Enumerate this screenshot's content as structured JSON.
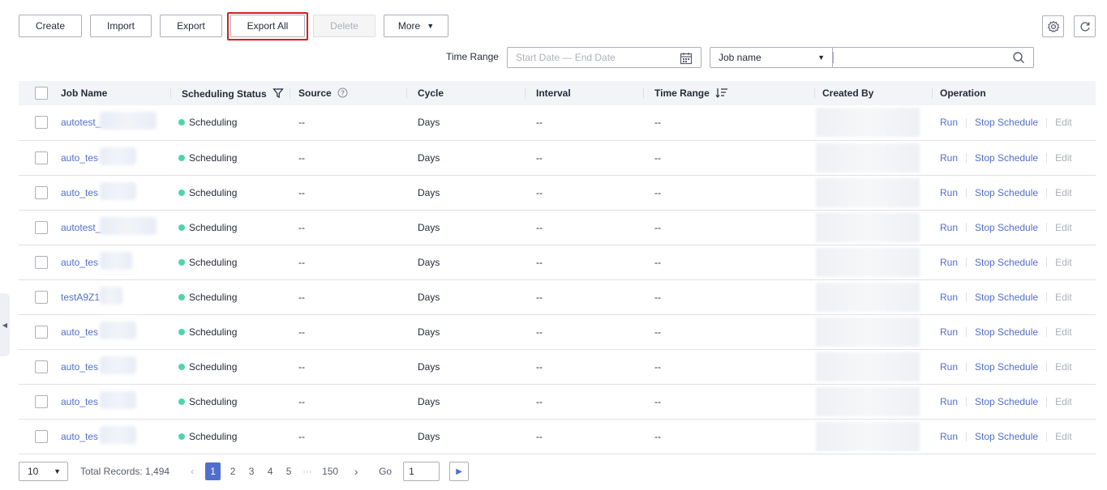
{
  "toolbar": {
    "create": "Create",
    "import": "Import",
    "export": "Export",
    "export_all": "Export All",
    "delete": "Delete",
    "more": "More"
  },
  "filters": {
    "time_range_label": "Time Range",
    "date_placeholder": "Start Date — End Date",
    "field_select": "Job name",
    "search_value": ""
  },
  "table": {
    "headers": {
      "job_name": "Job Name",
      "scheduling_status": "Scheduling Status",
      "source": "Source",
      "cycle": "Cycle",
      "interval": "Interval",
      "time_range": "Time Range",
      "created_by": "Created By",
      "operation": "Operation"
    },
    "rows": [
      {
        "name": "autotest_",
        "status": "Scheduling",
        "source": "--",
        "cycle": "Days",
        "interval": "--",
        "time_range": "--"
      },
      {
        "name": "auto_tes",
        "status": "Scheduling",
        "source": "--",
        "cycle": "Days",
        "interval": "--",
        "time_range": "--"
      },
      {
        "name": "auto_tes",
        "status": "Scheduling",
        "source": "--",
        "cycle": "Days",
        "interval": "--",
        "time_range": "--"
      },
      {
        "name": "autotest_",
        "status": "Scheduling",
        "source": "--",
        "cycle": "Days",
        "interval": "--",
        "time_range": "--"
      },
      {
        "name": "auto_tes",
        "status": "Scheduling",
        "source": "--",
        "cycle": "Days",
        "interval": "--",
        "time_range": "--"
      },
      {
        "name": "testA9Z1",
        "status": "Scheduling",
        "source": "--",
        "cycle": "Days",
        "interval": "--",
        "time_range": "--"
      },
      {
        "name": "auto_tes",
        "status": "Scheduling",
        "source": "--",
        "cycle": "Days",
        "interval": "--",
        "time_range": "--"
      },
      {
        "name": "auto_tes",
        "status": "Scheduling",
        "source": "--",
        "cycle": "Days",
        "interval": "--",
        "time_range": "--"
      },
      {
        "name": "auto_tes",
        "status": "Scheduling",
        "source": "--",
        "cycle": "Days",
        "interval": "--",
        "time_range": "--"
      },
      {
        "name": "auto_tes",
        "status": "Scheduling",
        "source": "--",
        "cycle": "Days",
        "interval": "--",
        "time_range": "--"
      }
    ],
    "operations": {
      "run": "Run",
      "stop": "Stop Schedule",
      "edit": "Edit"
    }
  },
  "pagination": {
    "page_size": "10",
    "total": "Total Records: 1,494",
    "pages": [
      "1",
      "2",
      "3",
      "4",
      "5",
      "···",
      "150"
    ],
    "current_page": "1",
    "go_label": "Go",
    "go_value": "1"
  },
  "colors": {
    "accent": "#526ecc",
    "status_dot": "#50d4ab",
    "highlight": "#d42020"
  }
}
